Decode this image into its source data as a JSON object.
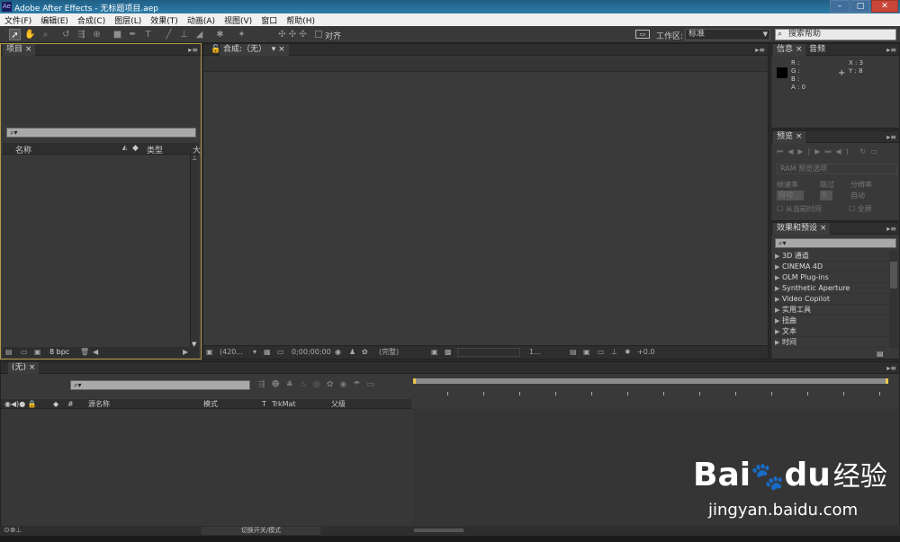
{
  "window": {
    "title": "Adobe After Effects - 无标题项目.aep",
    "app_icon": "Ae"
  },
  "menu": [
    "文件(F)",
    "编辑(E)",
    "合成(C)",
    "图层(L)",
    "效果(T)",
    "动画(A)",
    "视图(V)",
    "窗口",
    "帮助(H)"
  ],
  "toolbar": {
    "align_label": "对齐",
    "workspace_label": "工作区:",
    "workspace_value": "标准",
    "search_placeholder": "搜索帮助"
  },
  "project_panel": {
    "tab": "项目",
    "col_name": "名称",
    "col_type": "类型",
    "col_size": "大",
    "bpc": "8 bpc"
  },
  "comp_panel": {
    "tab": "合成:（无）",
    "zoom": "(420...",
    "timecode": "0;00;00;00",
    "quality": "(完整)",
    "camera": "1...",
    "exposure": "+0.0"
  },
  "info_panel": {
    "tab": "信息",
    "tab2": "音频",
    "r": "R :",
    "g": "G :",
    "b": "B :",
    "a": "A : 0",
    "x": "X : 3",
    "y": "Y : 8"
  },
  "preview_panel": {
    "tab": "预览",
    "ram_options": "RAM 预览选项",
    "frame_rate_label": "帧速率",
    "skip_label": "跳过",
    "resolution_label": "分辨率",
    "frame_rate_value": "自动",
    "skip_value": "0",
    "resolution_value": "自动",
    "from_current": "从当前时间",
    "fullscreen": "全屏"
  },
  "effects_panel": {
    "tab": "效果和预设",
    "items": [
      "3D 通道",
      "CINEMA 4D",
      "OLM Plug-ins",
      "Synthetic Aperture",
      "Video Copilot",
      "实用工具",
      "扭曲",
      "文本",
      "时间"
    ]
  },
  "timeline": {
    "tab": "(无)",
    "col_source": "源名称",
    "col_mode": "模式",
    "col_t": "T",
    "col_trkmat": "TrkMat",
    "col_parent": "父级",
    "col_hash": "#",
    "toggle_label": "切换开关/模式"
  },
  "watermark": {
    "logo_text_a": "Bai",
    "logo_text_b": "du",
    "brand_cn": "经验",
    "url": "jingyan.baidu.com"
  },
  "colors": {
    "titlebar": "#2f7da9",
    "panel_bg": "#3a3939",
    "comp_bg": "#3b3a3a",
    "tab_bg": "#2f2e2e"
  }
}
